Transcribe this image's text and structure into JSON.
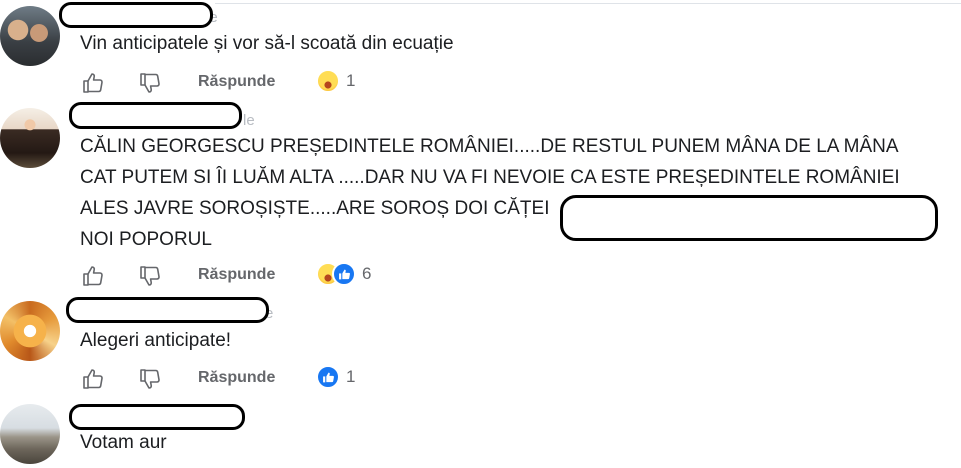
{
  "comments": [
    {
      "ghost": "le",
      "lines": [
        "Vin anticipatele și vor să-l scoată din ecuație"
      ],
      "reply_label": "Răspunde",
      "reaction_count": "1"
    },
    {
      "ghost": "le",
      "lines": [
        "CĂLIN GEORGESCU PREȘEDINTELE ROMÂNIEI.....DE RESTUL PUNEM MÂNA DE LA MÂNA",
        "CAT PUTEM SI ÎI LUĂM ALTA .....DAR NU VA FI NEVOIE CA ESTE PREȘEDINTELE ROMÂNIEI",
        "ALES JAVRE SOROȘIȘTE.....ARE SOROȘ DOI CĂȚEI",
        "NOI POPORUL"
      ],
      "reply_label": "Răspunde",
      "reaction_count": "6"
    },
    {
      "ghost": "e",
      "lines": [
        "Alegeri anticipate!"
      ],
      "reply_label": "Răspunde",
      "reaction_count": "1"
    },
    {
      "ghost": "",
      "lines": [
        "Votam aur"
      ]
    }
  ],
  "icons": {
    "like": "thumbs-up-icon",
    "dislike": "thumbs-down-icon",
    "haha": "haha-reaction-icon",
    "like_reaction": "like-reaction-icon"
  },
  "colors": {
    "text": "#1c1e21",
    "secondary": "#65676b",
    "like_blue": "#1877f2"
  }
}
